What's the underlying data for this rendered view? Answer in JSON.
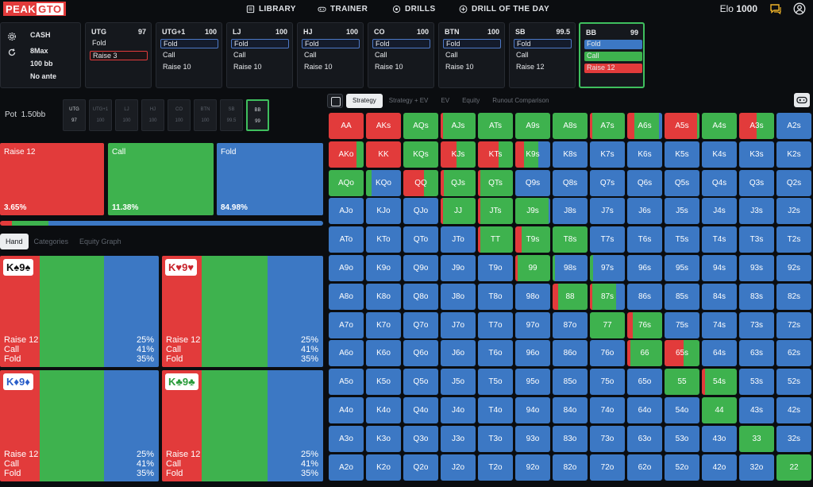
{
  "colors": {
    "raise": "#e23b3b",
    "call": "#3eb24e",
    "fold": "#3c78c4",
    "accent_green": "#3fbf5e"
  },
  "logo": {
    "part1": "PEAK",
    "part2": "GTO"
  },
  "nav": [
    {
      "label": "LIBRARY",
      "icon": "library-icon"
    },
    {
      "label": "TRAINER",
      "icon": "gamepad-icon"
    },
    {
      "label": "DRILLS",
      "icon": "drills-icon"
    },
    {
      "label": "DRILL OF THE DAY",
      "icon": "plus-circle-icon"
    }
  ],
  "elo": {
    "label": "Elo",
    "value": "1000"
  },
  "game_info": {
    "type": "CASH",
    "table": "8Max",
    "depth": "100 bb",
    "ante": "No ante"
  },
  "seats": [
    {
      "pos": "UTG",
      "stack": "97",
      "actions": [
        {
          "label": "Fold",
          "style": "plain"
        },
        {
          "label": "Raise 3",
          "style": "raise-out"
        }
      ]
    },
    {
      "pos": "UTG+1",
      "stack": "100",
      "actions": [
        {
          "label": "Fold",
          "style": "fold-sel"
        },
        {
          "label": "Call",
          "style": "plain"
        },
        {
          "label": "Raise 10",
          "style": "plain"
        }
      ]
    },
    {
      "pos": "LJ",
      "stack": "100",
      "actions": [
        {
          "label": "Fold",
          "style": "fold-sel"
        },
        {
          "label": "Call",
          "style": "plain"
        },
        {
          "label": "Raise 10",
          "style": "plain"
        }
      ]
    },
    {
      "pos": "HJ",
      "stack": "100",
      "actions": [
        {
          "label": "Fold",
          "style": "fold-sel"
        },
        {
          "label": "Call",
          "style": "plain"
        },
        {
          "label": "Raise 10",
          "style": "plain"
        }
      ]
    },
    {
      "pos": "CO",
      "stack": "100",
      "actions": [
        {
          "label": "Fold",
          "style": "fold-sel"
        },
        {
          "label": "Call",
          "style": "plain"
        },
        {
          "label": "Raise 10",
          "style": "plain"
        }
      ]
    },
    {
      "pos": "BTN",
      "stack": "100",
      "actions": [
        {
          "label": "Fold",
          "style": "fold-sel"
        },
        {
          "label": "Call",
          "style": "plain"
        },
        {
          "label": "Raise 10",
          "style": "plain"
        }
      ]
    },
    {
      "pos": "SB",
      "stack": "99.5",
      "actions": [
        {
          "label": "Fold",
          "style": "fold-sel"
        },
        {
          "label": "Call",
          "style": "plain"
        },
        {
          "label": "Raise 12",
          "style": "plain"
        }
      ]
    },
    {
      "pos": "BB",
      "stack": "99",
      "actions": [
        {
          "label": "Fold",
          "style": "fold-blue"
        },
        {
          "label": "Call",
          "style": "call-green"
        },
        {
          "label": "Raise 12",
          "style": "raise-red"
        }
      ]
    }
  ],
  "pot": {
    "label": "Pot",
    "value": "1.50bb"
  },
  "history": [
    {
      "pos": "UTG",
      "stack": "97"
    },
    {
      "pos": "UTG+1",
      "stack": "100"
    },
    {
      "pos": "LJ",
      "stack": "100"
    },
    {
      "pos": "HJ",
      "stack": "100"
    },
    {
      "pos": "CO",
      "stack": "100"
    },
    {
      "pos": "BTN",
      "stack": "100"
    },
    {
      "pos": "SB",
      "stack": "99.5"
    },
    {
      "pos": "BB",
      "stack": "99"
    }
  ],
  "actions_summary": [
    {
      "name": "Raise 12",
      "pct": "3.65%",
      "frac": 0.0365
    },
    {
      "name": "Call",
      "pct": "11.38%",
      "frac": 0.1138
    },
    {
      "name": "Fold",
      "pct": "84.98%",
      "frac": 0.8498
    }
  ],
  "sub_tabs": [
    "Hand",
    "Categories",
    "Equity Graph"
  ],
  "hand_combos": [
    {
      "rank": "K",
      "suit": "♠",
      "rank2": "9",
      "suit2": "♠",
      "suit_color": "#111111",
      "freqs": [
        0.25,
        0.41,
        0.35
      ],
      "rows": [
        {
          "label": "Raise 12",
          "value": "25%"
        },
        {
          "label": "Call",
          "value": "41%"
        },
        {
          "label": "Fold",
          "value": "35%"
        }
      ]
    },
    {
      "rank": "K",
      "suit": "♥",
      "rank2": "9",
      "suit2": "♥",
      "suit_color": "#c9242c",
      "freqs": [
        0.25,
        0.41,
        0.35
      ],
      "rows": [
        {
          "label": "Raise 12",
          "value": "25%"
        },
        {
          "label": "Call",
          "value": "41%"
        },
        {
          "label": "Fold",
          "value": "35%"
        }
      ]
    },
    {
      "rank": "K",
      "suit": "♦",
      "rank2": "9",
      "suit2": "♦",
      "suit_color": "#2b5fc9",
      "freqs": [
        0.25,
        0.41,
        0.35
      ],
      "rows": [
        {
          "label": "Raise 12",
          "value": "25%"
        },
        {
          "label": "Call",
          "value": "41%"
        },
        {
          "label": "Fold",
          "value": "35%"
        }
      ]
    },
    {
      "rank": "K",
      "suit": "♣",
      "rank2": "9",
      "suit2": "♣",
      "suit_color": "#2a9c3b",
      "freqs": [
        0.25,
        0.41,
        0.35
      ],
      "rows": [
        {
          "label": "Raise 12",
          "value": "25%"
        },
        {
          "label": "Call",
          "value": "41%"
        },
        {
          "label": "Fold",
          "value": "35%"
        }
      ]
    }
  ],
  "range_tabs": [
    "Strategy",
    "Strategy + EV",
    "EV",
    "Equity",
    "Runout Comparison"
  ],
  "range_grid": {
    "ranks": [
      "A",
      "K",
      "Q",
      "J",
      "T",
      "9",
      "8",
      "7",
      "6",
      "5",
      "4",
      "3",
      "2"
    ],
    "cells": {
      "AA": [
        1,
        0,
        0
      ],
      "AKs": [
        1,
        0,
        0
      ],
      "AQs": [
        0,
        1,
        0
      ],
      "AJs": [
        0.06,
        0.94,
        0
      ],
      "ATs": [
        0,
        1,
        0
      ],
      "A9s": [
        0,
        1,
        0
      ],
      "A8s": [
        0,
        1,
        0
      ],
      "A7s": [
        0.06,
        0.94,
        0
      ],
      "A6s": [
        0.2,
        0.7,
        0.1
      ],
      "A5s": [
        0.94,
        0.06,
        0
      ],
      "A4s": [
        0,
        1,
        0
      ],
      "A3s": [
        0.5,
        0.5,
        0
      ],
      "A2s": [
        0,
        0,
        1
      ],
      "AKo": [
        0.8,
        0.2,
        0
      ],
      "KK": [
        1,
        0,
        0
      ],
      "KQs": [
        0,
        1,
        0
      ],
      "KJs": [
        0.45,
        0.55,
        0
      ],
      "KTs": [
        0.6,
        0.4,
        0
      ],
      "K9s": [
        0.25,
        0.41,
        0.34
      ],
      "K8s": [
        0,
        0,
        1
      ],
      "K7s": [
        0,
        0,
        1
      ],
      "K6s": [
        0,
        0,
        1
      ],
      "K5s": [
        0,
        0,
        1
      ],
      "K4s": [
        0,
        0,
        1
      ],
      "K3s": [
        0,
        0,
        1
      ],
      "K2s": [
        0,
        0,
        1
      ],
      "AQo": [
        0,
        1,
        0
      ],
      "KQo": [
        0,
        0.15,
        0.85
      ],
      "QQ": [
        0.6,
        0.4,
        0
      ],
      "QJs": [
        0.1,
        0.9,
        0
      ],
      "QTs": [
        0.06,
        0.94,
        0
      ],
      "Q9s": [
        0,
        0,
        1
      ],
      "Q8s": [
        0,
        0,
        1
      ],
      "Q7s": [
        0,
        0,
        1
      ],
      "Q6s": [
        0,
        0,
        1
      ],
      "Q5s": [
        0,
        0,
        1
      ],
      "Q4s": [
        0,
        0,
        1
      ],
      "Q3s": [
        0,
        0,
        1
      ],
      "Q2s": [
        0,
        0,
        1
      ],
      "AJo": [
        0,
        0,
        1
      ],
      "KJo": [
        0,
        0,
        1
      ],
      "QJo": [
        0,
        0,
        1
      ],
      "JJ": [
        0.06,
        0.94,
        0
      ],
      "JTs": [
        0.06,
        0.94,
        0
      ],
      "J9s": [
        0,
        0.95,
        0.05
      ],
      "J8s": [
        0,
        0,
        1
      ],
      "J7s": [
        0,
        0,
        1
      ],
      "J6s": [
        0,
        0,
        1
      ],
      "J5s": [
        0,
        0,
        1
      ],
      "J4s": [
        0,
        0,
        1
      ],
      "J3s": [
        0,
        0,
        1
      ],
      "J2s": [
        0,
        0,
        1
      ],
      "ATo": [
        0,
        0,
        1
      ],
      "KTo": [
        0,
        0,
        1
      ],
      "QTo": [
        0,
        0,
        1
      ],
      "JTo": [
        0,
        0,
        1
      ],
      "TT": [
        0.06,
        0.94,
        0
      ],
      "T9s": [
        0.18,
        0.82,
        0
      ],
      "T8s": [
        0,
        1,
        0
      ],
      "T7s": [
        0,
        0,
        1
      ],
      "T6s": [
        0,
        0,
        1
      ],
      "T5s": [
        0,
        0,
        1
      ],
      "T4s": [
        0,
        0,
        1
      ],
      "T3s": [
        0,
        0,
        1
      ],
      "T2s": [
        0,
        0,
        1
      ],
      "A9o": [
        0,
        0,
        1
      ],
      "K9o": [
        0,
        0,
        1
      ],
      "Q9o": [
        0,
        0,
        1
      ],
      "J9o": [
        0,
        0,
        1
      ],
      "T9o": [
        0,
        0,
        1
      ],
      "99": [
        0.06,
        0.94,
        0
      ],
      "98s": [
        0,
        0.06,
        0.94
      ],
      "97s": [
        0,
        0.1,
        0.9
      ],
      "96s": [
        0,
        0,
        1
      ],
      "95s": [
        0,
        0,
        1
      ],
      "94s": [
        0,
        0,
        1
      ],
      "93s": [
        0,
        0,
        1
      ],
      "92s": [
        0,
        0,
        1
      ],
      "A8o": [
        0,
        0,
        1
      ],
      "K8o": [
        0,
        0,
        1
      ],
      "Q8o": [
        0,
        0,
        1
      ],
      "J8o": [
        0,
        0,
        1
      ],
      "T8o": [
        0,
        0,
        1
      ],
      "98o": [
        0,
        0,
        1
      ],
      "88": [
        0.15,
        0.85,
        0
      ],
      "87s": [
        0.06,
        0.7,
        0.24
      ],
      "86s": [
        0,
        0,
        1
      ],
      "85s": [
        0,
        0,
        1
      ],
      "84s": [
        0,
        0,
        1
      ],
      "83s": [
        0,
        0,
        1
      ],
      "82s": [
        0,
        0,
        1
      ],
      "A7o": [
        0,
        0,
        1
      ],
      "K7o": [
        0,
        0,
        1
      ],
      "Q7o": [
        0,
        0,
        1
      ],
      "J7o": [
        0,
        0,
        1
      ],
      "T7o": [
        0,
        0,
        1
      ],
      "97o": [
        0,
        0,
        1
      ],
      "87o": [
        0,
        0,
        1
      ],
      "77": [
        0,
        1,
        0
      ],
      "76s": [
        0.16,
        0.84,
        0
      ],
      "75s": [
        0,
        0,
        1
      ],
      "74s": [
        0,
        0,
        1
      ],
      "73s": [
        0,
        0,
        1
      ],
      "72s": [
        0,
        0,
        1
      ],
      "A6o": [
        0,
        0,
        1
      ],
      "K6o": [
        0,
        0,
        1
      ],
      "Q6o": [
        0,
        0,
        1
      ],
      "J6o": [
        0,
        0,
        1
      ],
      "T6o": [
        0,
        0,
        1
      ],
      "96o": [
        0,
        0,
        1
      ],
      "86o": [
        0,
        0,
        1
      ],
      "76o": [
        0,
        0,
        1
      ],
      "66": [
        0.1,
        0.9,
        0
      ],
      "65s": [
        0.55,
        0.45,
        0
      ],
      "64s": [
        0,
        0,
        1
      ],
      "63s": [
        0,
        0,
        1
      ],
      "62s": [
        0,
        0,
        1
      ],
      "A5o": [
        0,
        0,
        1
      ],
      "K5o": [
        0,
        0,
        1
      ],
      "Q5o": [
        0,
        0,
        1
      ],
      "J5o": [
        0,
        0,
        1
      ],
      "T5o": [
        0,
        0,
        1
      ],
      "95o": [
        0,
        0,
        1
      ],
      "85o": [
        0,
        0,
        1
      ],
      "75o": [
        0,
        0,
        1
      ],
      "65o": [
        0,
        0,
        1
      ],
      "55": [
        0,
        1,
        0
      ],
      "54s": [
        0.1,
        0.9,
        0
      ],
      "53s": [
        0,
        0,
        1
      ],
      "52s": [
        0,
        0,
        1
      ],
      "A4o": [
        0,
        0,
        1
      ],
      "K4o": [
        0,
        0,
        1
      ],
      "Q4o": [
        0,
        0,
        1
      ],
      "J4o": [
        0,
        0,
        1
      ],
      "T4o": [
        0,
        0,
        1
      ],
      "94o": [
        0,
        0,
        1
      ],
      "84o": [
        0,
        0,
        1
      ],
      "74o": [
        0,
        0,
        1
      ],
      "64o": [
        0,
        0,
        1
      ],
      "54o": [
        0,
        0,
        1
      ],
      "44": [
        0,
        1,
        0
      ],
      "43s": [
        0,
        0,
        1
      ],
      "42s": [
        0,
        0,
        1
      ],
      "A3o": [
        0,
        0,
        1
      ],
      "K3o": [
        0,
        0,
        1
      ],
      "Q3o": [
        0,
        0,
        1
      ],
      "J3o": [
        0,
        0,
        1
      ],
      "T3o": [
        0,
        0,
        1
      ],
      "93o": [
        0,
        0,
        1
      ],
      "83o": [
        0,
        0,
        1
      ],
      "73o": [
        0,
        0,
        1
      ],
      "63o": [
        0,
        0,
        1
      ],
      "53o": [
        0,
        0,
        1
      ],
      "43o": [
        0,
        0,
        1
      ],
      "33": [
        0,
        1,
        0
      ],
      "32s": [
        0,
        0,
        1
      ],
      "A2o": [
        0,
        0,
        1
      ],
      "K2o": [
        0,
        0,
        1
      ],
      "Q2o": [
        0,
        0,
        1
      ],
      "J2o": [
        0,
        0,
        1
      ],
      "T2o": [
        0,
        0,
        1
      ],
      "92o": [
        0,
        0,
        1
      ],
      "82o": [
        0,
        0,
        1
      ],
      "72o": [
        0,
        0,
        1
      ],
      "62o": [
        0,
        0,
        1
      ],
      "52o": [
        0,
        0,
        1
      ],
      "42o": [
        0,
        0,
        1
      ],
      "32o": [
        0,
        0,
        1
      ],
      "22": [
        0,
        1,
        0
      ]
    }
  }
}
